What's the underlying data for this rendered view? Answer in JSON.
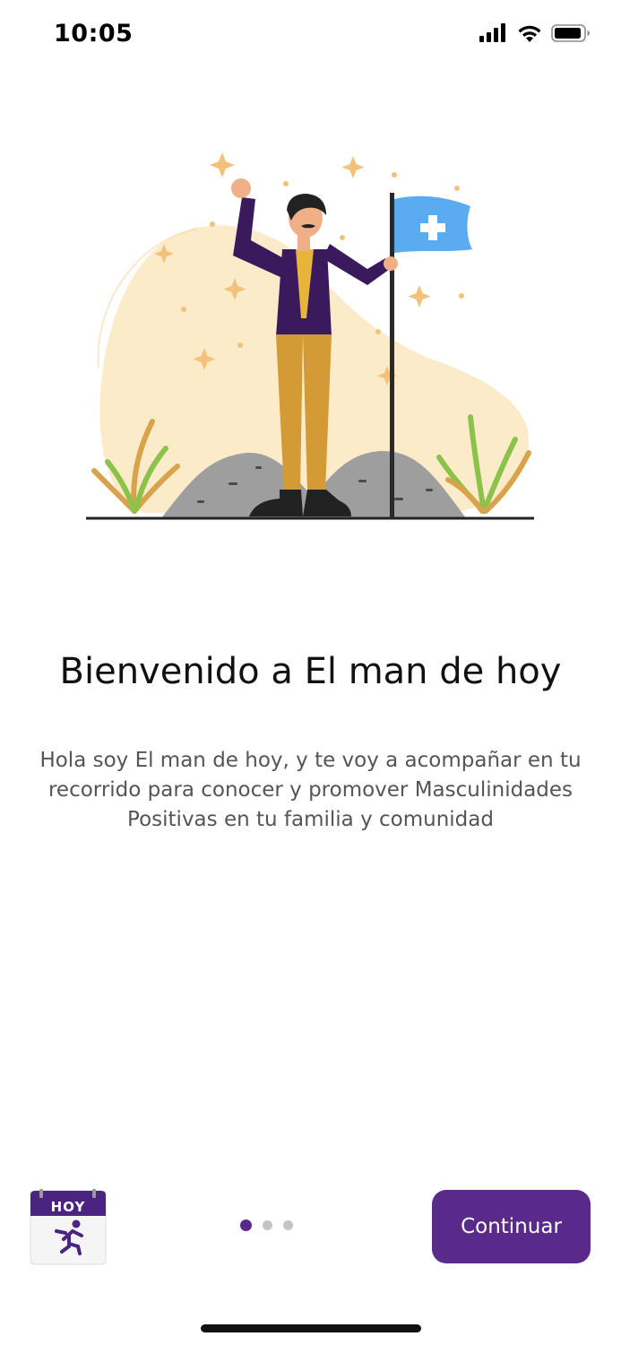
{
  "status_bar": {
    "time": "10:05",
    "icons": [
      "signal-icon",
      "wifi-icon",
      "battery-icon"
    ]
  },
  "onboarding": {
    "title": "Bienvenido a El man de hoy",
    "description": "Hola soy El man de hoy, y te voy a acompañar en tu recorrido para conocer y promover Masculinidades Positivas en tu familia y comunidad",
    "illustration": "man-with-flag-illustration",
    "pager": {
      "total": 3,
      "current": 1
    }
  },
  "footer": {
    "logo_text": "HOY",
    "continue_label": "Continuar"
  },
  "colors": {
    "primary": "#5a2a8a",
    "flag": "#5aabf0",
    "sun_blob": "#fcebc9",
    "dot_inactive": "#c4c4c4"
  }
}
